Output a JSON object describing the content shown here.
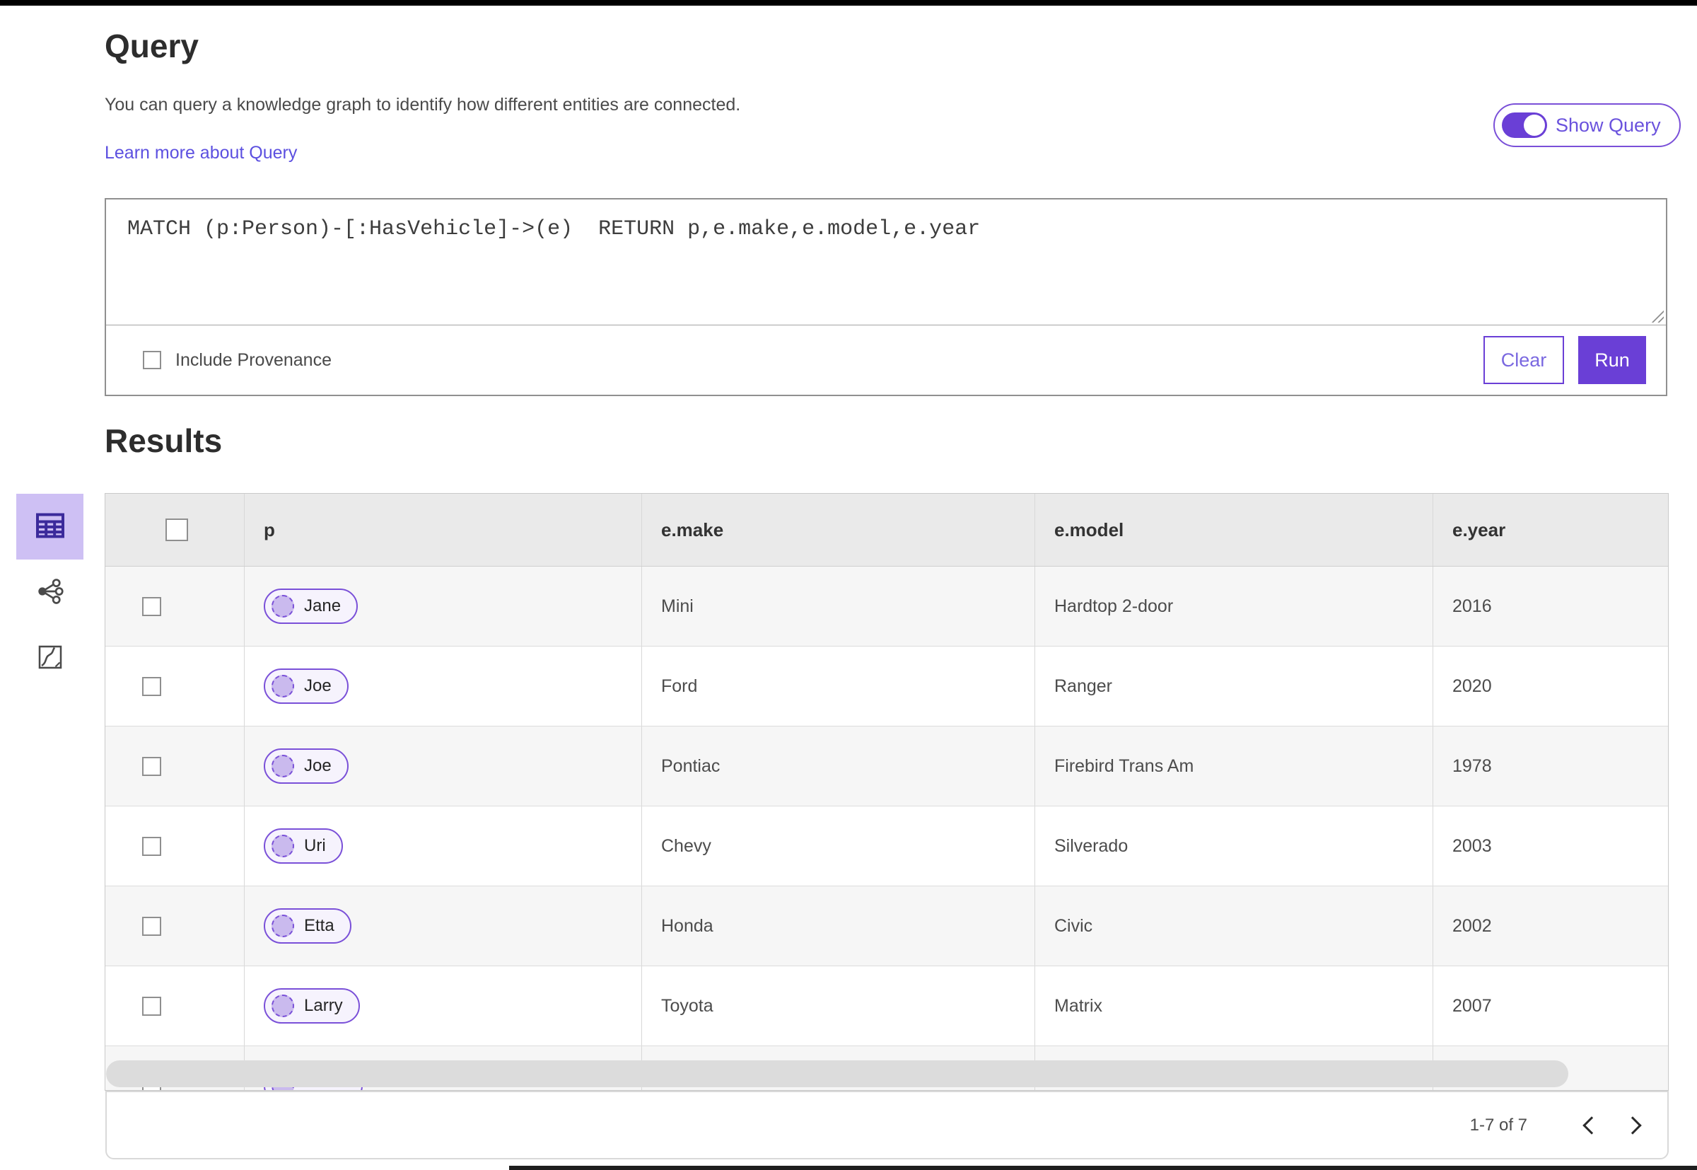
{
  "query_panel": {
    "title": "Query",
    "description": "You can query a knowledge graph to identify how different entities are connected.",
    "learn_more_link": "Learn more about Query",
    "show_query_label": "Show Query",
    "show_query_on": true,
    "query_text": "MATCH (p:Person)-[:HasVehicle]->(e)  RETURN p,e.make,e.model,e.year",
    "include_provenance_label": "Include Provenance",
    "include_provenance_checked": false,
    "clear_label": "Clear",
    "run_label": "Run"
  },
  "results": {
    "title": "Results",
    "view_switcher": [
      {
        "icon": "table-view-icon",
        "selected": true
      },
      {
        "icon": "link-chart-view-icon",
        "selected": false
      },
      {
        "icon": "map-view-icon",
        "selected": false
      }
    ],
    "table": {
      "columns": [
        "p",
        "e.make",
        "e.model",
        "e.year"
      ],
      "rows": [
        {
          "p": "Jane",
          "make": "Mini",
          "model": "Hardtop 2-door",
          "year": "2016",
          "partial": false
        },
        {
          "p": "Joe",
          "make": "Ford",
          "model": "Ranger",
          "year": "2020",
          "partial": false
        },
        {
          "p": "Joe",
          "make": "Pontiac",
          "model": "Firebird Trans Am",
          "year": "1978",
          "partial": false
        },
        {
          "p": "Uri",
          "make": "Chevy",
          "model": "Silverado",
          "year": "2003",
          "partial": false
        },
        {
          "p": "Etta",
          "make": "Honda",
          "model": "Civic",
          "year": "2002",
          "partial": false
        },
        {
          "p": "Larry",
          "make": "Toyota",
          "model": "Matrix",
          "year": "2007",
          "partial": false
        },
        {
          "p": "",
          "make": "",
          "model": "",
          "year": "",
          "partial": true
        }
      ]
    },
    "pagination": {
      "range_label": "1-7 of 7"
    }
  },
  "colors": {
    "accent_purple": "#6a3fd6",
    "pill_border_purple": "#7a50d8",
    "selected_view_bg": "#cec0f4",
    "selected_view_icon": "#3b2a9b",
    "link_color": "#5c50e0",
    "table_header_bg": "#eaeaea",
    "row_alt_bg": "#f6f6f6"
  }
}
